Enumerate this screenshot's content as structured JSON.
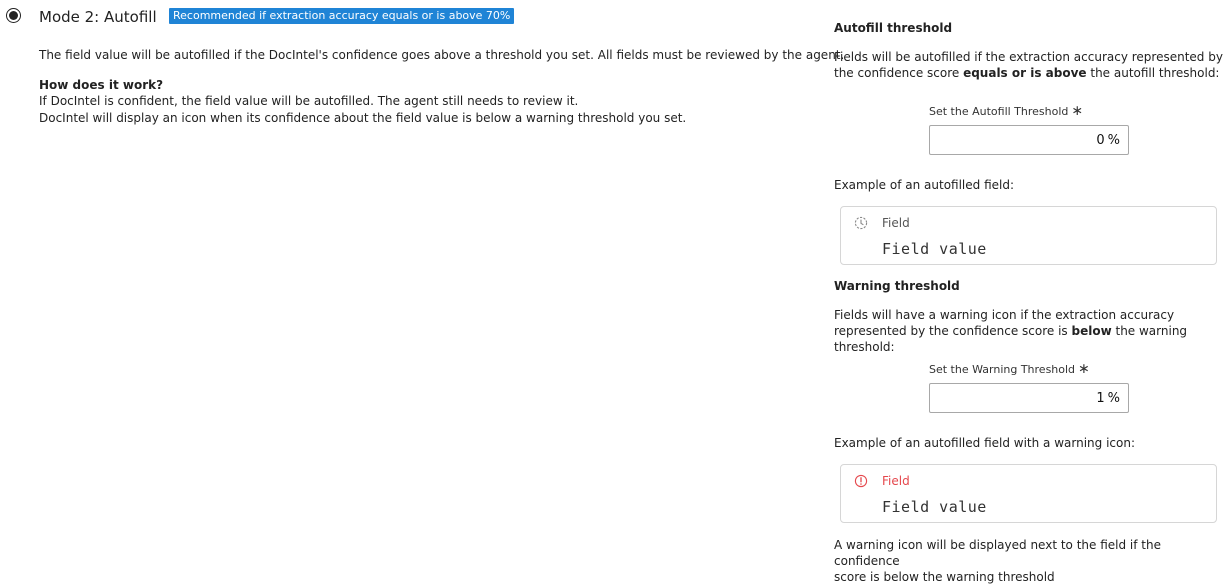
{
  "mode": {
    "title": "Mode 2: Autofill",
    "badge": "Recommended if extraction accuracy equals or is above 70%",
    "selected": true,
    "description": "The field value will be autofilled if the DocIntel's confidence goes above a threshold you set. All fields must be reviewed by the agent.",
    "how_title": "How does it work?",
    "how_lines": [
      "If DocIntel is confident, the field value will be autofilled. The agent still needs to review it.",
      "DocIntel will display an icon when its confidence about the field value is below a warning threshold you set."
    ]
  },
  "autofill": {
    "title": "Autofill threshold",
    "desc_pre": "Fields will be autofilled if the extraction accuracy represented by the confidence score ",
    "desc_bold": "equals or is above",
    "desc_post": " the autofill threshold:",
    "input_label": "Set the Autofill Threshold",
    "required_mark": "∗",
    "value": "0",
    "unit": "%",
    "example_title": "Example of an autofilled field:",
    "example_field_label": "Field",
    "example_field_value": "Field value",
    "example_icon": "autofill-clock-icon"
  },
  "warning": {
    "title": "Warning threshold",
    "desc_line1": "Fields will have a warning icon if the extraction accuracy",
    "desc_pre": "represented by the confidence score is ",
    "desc_bold": "below",
    "desc_post": " the warning threshold:",
    "input_label": "Set the Warning Threshold",
    "required_mark": "∗",
    "value": "1",
    "unit": "%",
    "example_title": "Example of an autofilled field with a warning icon:",
    "example_field_label": "Field",
    "example_field_value": "Field value",
    "example_icon": "warning-circle-icon",
    "footnote_line1": "A warning icon will be displayed next to the field if the confidence",
    "footnote_line2": "score is below the warning threshold"
  },
  "colors": {
    "badge_bg": "#1f84d6",
    "warning": "#e5484d"
  }
}
